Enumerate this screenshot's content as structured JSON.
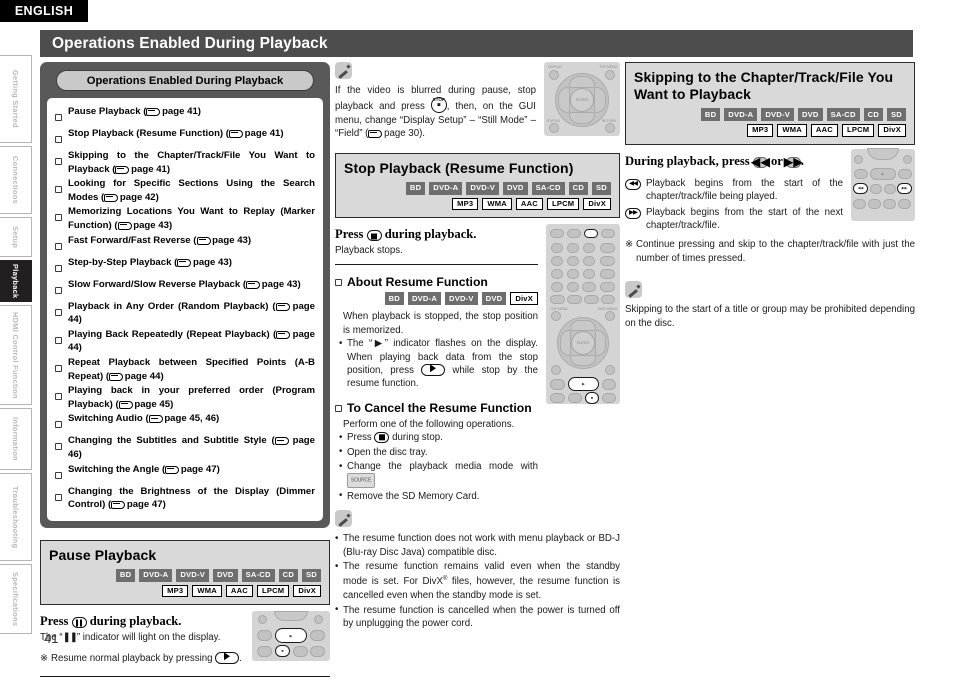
{
  "language_tab": "ENGLISH",
  "page_number": "41",
  "sidebar": {
    "items": [
      {
        "label": "Getting Started",
        "active": false
      },
      {
        "label": "Connections",
        "active": false
      },
      {
        "label": "Setup",
        "active": false
      },
      {
        "label": "Playback",
        "active": true
      },
      {
        "label": "HDMI Control Function",
        "active": false
      },
      {
        "label": "Information",
        "active": false
      },
      {
        "label": "Troubleshooting",
        "active": false
      },
      {
        "label": "Specifications",
        "active": false
      }
    ]
  },
  "header": {
    "title": "Operations Enabled During Playback"
  },
  "media_badges": {
    "row1": [
      "BD",
      "DVD-A",
      "DVD-V",
      "DVD",
      "SA-CD",
      "CD",
      "SD"
    ],
    "row2": [
      "MP3",
      "WMA",
      "AAC",
      "LPCM",
      "DivX"
    ],
    "resume_row": [
      "BD",
      "DVD-A",
      "DVD-V",
      "DVD",
      "DivX"
    ]
  },
  "index_box": {
    "title": "Operations Enabled During Playback",
    "items": [
      "Pause Playback (<PTR> page 41)",
      "Stop Playback (Resume Function) (<PTR> page 41)",
      "Skipping to the Chapter/Track/File You Want to Playback (<PTR> page 41)",
      "Looking for Specific Sections Using the Search Modes (<PTR> page 42)",
      "Memorizing Locations You Want to Replay (Marker Function) (<PTR> page 43)",
      "Fast Forward/Fast Reverse (<PTR> page 43)",
      "Step-by-Step Playback (<PTR> page 43)",
      "Slow Forward/Slow Reverse Playback (<PTR> page 43)",
      "Playback in Any Order (Random Playback) (<PTR> page 44)",
      "Playing Back Repeatedly (Repeat Playback) (<PTR> page 44)",
      "Repeat Playback between Specified Points (A-B Repeat) (<PTR> page 44)",
      "Playing back in your preferred order (Program Playback) (<PTR> page 45)",
      "Switching Audio (<PTR> page 45, 46)",
      "Changing the Subtitles and Subtitle Style (<PTR> page 46)",
      "Switching the Angle (<PTR> page 47)",
      "Changing the Brightness of the Display (Dimmer Control) (<PTR> page 47)"
    ]
  },
  "pause_playback": {
    "title": "Pause Playback",
    "press_line": "Press <KEY_PAUSE> during playback.",
    "detail": "The “<PAUSE_IND>” indicator will light on the display.",
    "note": "Resume normal playback by pressing <KEY_PLAY>."
  },
  "mid_note_top": {
    "icon": "memo-icon",
    "text": "If the video is blurred during pause, stop playback and press <KEY_STOP_CIRCLE>, then, on the GUI menu, change “Display Setup” – “Still Mode” – “Field” (<PTR> page 30)."
  },
  "stop_playback": {
    "title": "Stop Playback (Resume Function)",
    "press_line": "Press <KEY_STOP> during playback.",
    "detail": "Playback stops.",
    "about": {
      "heading": "About Resume Function",
      "para": "When playback is stopped, the stop position is memorized.",
      "bullets": [
        "The “<PLAY_IND>” indicator flashes on the display. When playing back data from the stop position, press <KEY_PLAY> while stop by the resume function."
      ]
    },
    "cancel": {
      "heading": "To Cancel the Resume Function",
      "para": "Perform one of the following operations.",
      "bullets": [
        "Press <KEY_STOP> during stop.",
        "Open the disc tray.",
        "Change the playback media mode with <KEY_SOURCE>",
        "Remove the SD Memory Card."
      ]
    },
    "note": {
      "icon": "memo-icon",
      "bullets": [
        "The resume function does not work with menu playback or BD-J (Blu-ray Disc Java) compatible disc.",
        "The resume function remains valid even when the standby mode is set. For DivX<SUP> files, however, the resume function is cancelled even when the standby mode is set.",
        "The resume function is cancelled when the power is turned off by unplugging the power cord."
      ]
    }
  },
  "skipping": {
    "title": "Skipping to the Chapter/Track/File You Want to Playback",
    "press_line": "During playback, press <KEY_PREV> or <KEY_NEXT>.",
    "entries": [
      {
        "key": "prev",
        "text": "Playback begins from the start of the chapter/track/file being played."
      },
      {
        "key": "next",
        "text": "Playback begins from the start of the next chapter/track/file."
      }
    ],
    "note": "Continue pressing and skip to the chapter/track/file with just the number of times pressed.",
    "memo": {
      "icon": "memo-icon",
      "text": "Skipping to the start of a title or group may be prohibited depending on the disc."
    }
  },
  "remote_labels": {
    "dpad_top_left": "DISPLAY",
    "dpad_top_right": "TOP MENU",
    "dpad_bottom_left": "STATUS",
    "dpad_bottom_right": "RETURN",
    "enter": "ENTER",
    "keypad": [
      "1",
      "2",
      "3",
      "4",
      "5",
      "6",
      "7",
      "8",
      "9",
      "0"
    ],
    "source": "SOURCE"
  },
  "colors": {
    "title_bar": "#4d4d4d",
    "index_box": "#595959",
    "badge_dark": "#6e6e6e",
    "section_bg": "#d9d9d9",
    "active_tab": "#231f20",
    "remote_bg": "#d4d4d4"
  }
}
